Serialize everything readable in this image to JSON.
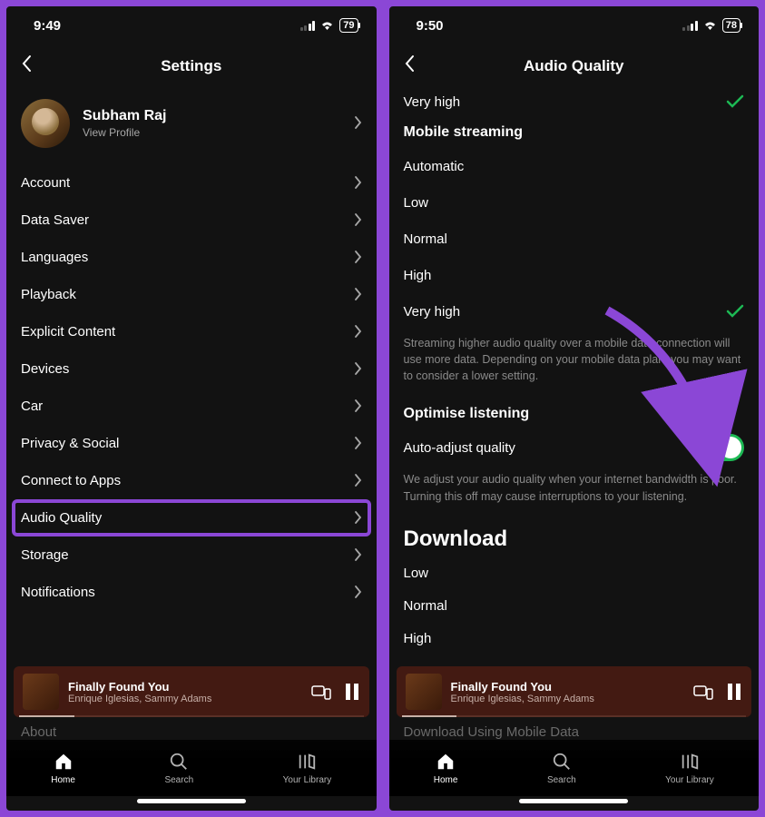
{
  "left": {
    "status": {
      "time": "9:49",
      "battery": "79"
    },
    "header": {
      "title": "Settings"
    },
    "profile": {
      "name": "Subham Raj",
      "sub": "View Profile"
    },
    "items": [
      {
        "label": "Account"
      },
      {
        "label": "Data Saver"
      },
      {
        "label": "Languages"
      },
      {
        "label": "Playback"
      },
      {
        "label": "Explicit Content"
      },
      {
        "label": "Devices"
      },
      {
        "label": "Car"
      },
      {
        "label": "Privacy & Social"
      },
      {
        "label": "Connect to Apps"
      },
      {
        "label": "Audio Quality",
        "highlighted": true
      },
      {
        "label": "Storage"
      },
      {
        "label": "Notifications"
      }
    ],
    "faded": "About"
  },
  "right": {
    "status": {
      "time": "9:50",
      "battery": "78"
    },
    "header": {
      "title": "Audio Quality"
    },
    "top_option": {
      "label": "Very high",
      "checked": true
    },
    "mobile_heading": "Mobile streaming",
    "mobile_options": [
      {
        "label": "Automatic"
      },
      {
        "label": "Low"
      },
      {
        "label": "Normal"
      },
      {
        "label": "High"
      },
      {
        "label": "Very high",
        "checked": true
      }
    ],
    "mobile_desc": "Streaming higher audio quality over a mobile data connection will use more data. Depending on your mobile data plan, you may want to consider a lower setting.",
    "optimise_heading": "Optimise listening",
    "auto_adjust_label": "Auto-adjust quality",
    "auto_adjust_desc": "We adjust your audio quality when your internet bandwidth is poor. Turning this off may cause interruptions to your listening.",
    "download_heading": "Download",
    "download_options": [
      {
        "label": "Low"
      },
      {
        "label": "Normal"
      },
      {
        "label": "High"
      }
    ],
    "faded": "Download Using Mobile Data"
  },
  "now_playing": {
    "title": "Finally Found You",
    "artist": "Enrique Iglesias, Sammy Adams"
  },
  "nav": {
    "home": "Home",
    "search": "Search",
    "library": "Your Library"
  }
}
